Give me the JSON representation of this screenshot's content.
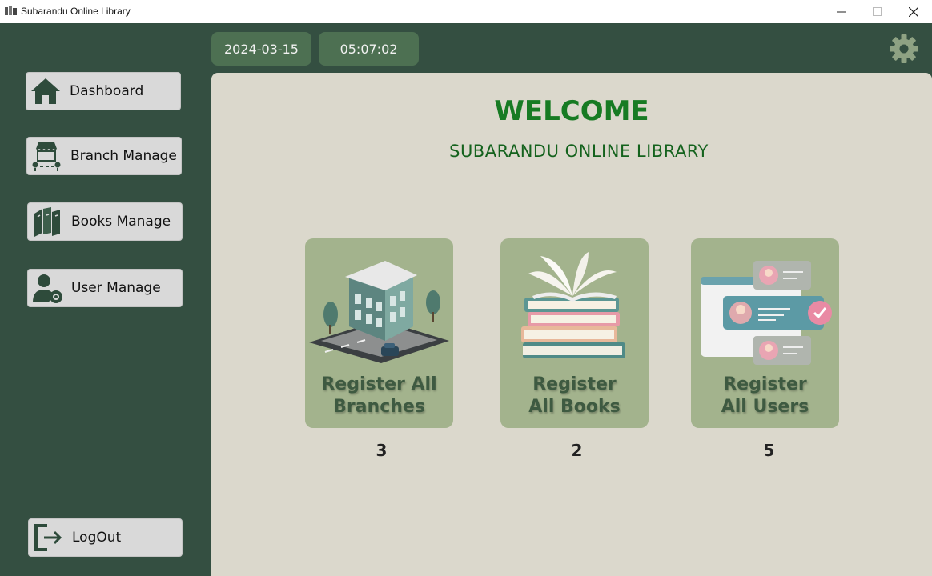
{
  "window": {
    "title": "Subarandu Online Library"
  },
  "topbar": {
    "date": "2024-03-15",
    "time": "05:07:02"
  },
  "sidebar": {
    "items": [
      {
        "label": "Dashboard",
        "icon": "home-icon"
      },
      {
        "label": "Branch Manage",
        "icon": "branch-store-icon"
      },
      {
        "label": "Books Manage",
        "icon": "books-icon"
      },
      {
        "label": "User Manage",
        "icon": "user-settings-icon"
      }
    ],
    "logout_label": "LogOut"
  },
  "main": {
    "welcome": "WELCOME",
    "subtitle": "SUBARANDU ONLINE LIBRARY",
    "cards": [
      {
        "label": "Register All\nBranches",
        "count": "3",
        "icon": "building-icon"
      },
      {
        "label": "Register\nAll Books",
        "count": "2",
        "icon": "book-stack-icon"
      },
      {
        "label": "Register\nAll Users",
        "count": "5",
        "icon": "user-profiles-icon"
      }
    ]
  },
  "colors": {
    "sidebar_bg": "#344f41",
    "panel_bg": "#dbd8cc",
    "card_bg": "#a3b38d",
    "welcome_green": "#177b23",
    "pill_bg": "#4d7052"
  }
}
